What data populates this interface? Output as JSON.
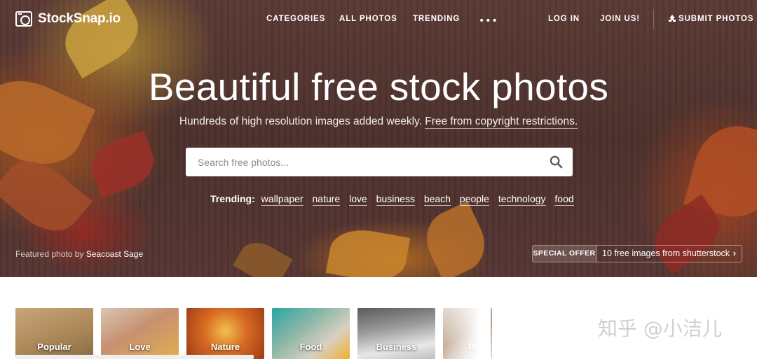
{
  "brand": {
    "name": "StockSnap.io"
  },
  "nav": {
    "categories": "CATEGORIES",
    "all_photos": "ALL PHOTOS",
    "trending": "TRENDING",
    "more": "•••",
    "login": "LOG IN",
    "join": "JOIN US!",
    "submit": "SUBMIT PHOTOS"
  },
  "hero": {
    "headline": "Beautiful free stock photos",
    "subtitle": "Hundreds of high resolution images added weekly.",
    "subtitle_link": "Free from copyright restrictions.",
    "featured_prefix": "Featured photo by",
    "featured_author": "Seacoast Sage"
  },
  "search": {
    "placeholder": "Search free photos..."
  },
  "trending": {
    "label": "Trending:",
    "tags": [
      "wallpaper",
      "nature",
      "love",
      "business",
      "beach",
      "people",
      "technology",
      "food"
    ]
  },
  "offer": {
    "badge": "SPECIAL OFFER",
    "text": "10 free images from shutterstock",
    "chevron": "›"
  },
  "categories": [
    "Popular",
    "Love",
    "Nature",
    "Food",
    "Business",
    "Pe"
  ],
  "watermark": "知乎 @小洁儿",
  "colors": {
    "hero_bg": "#4c302c",
    "page_bg": "#ffffff"
  }
}
